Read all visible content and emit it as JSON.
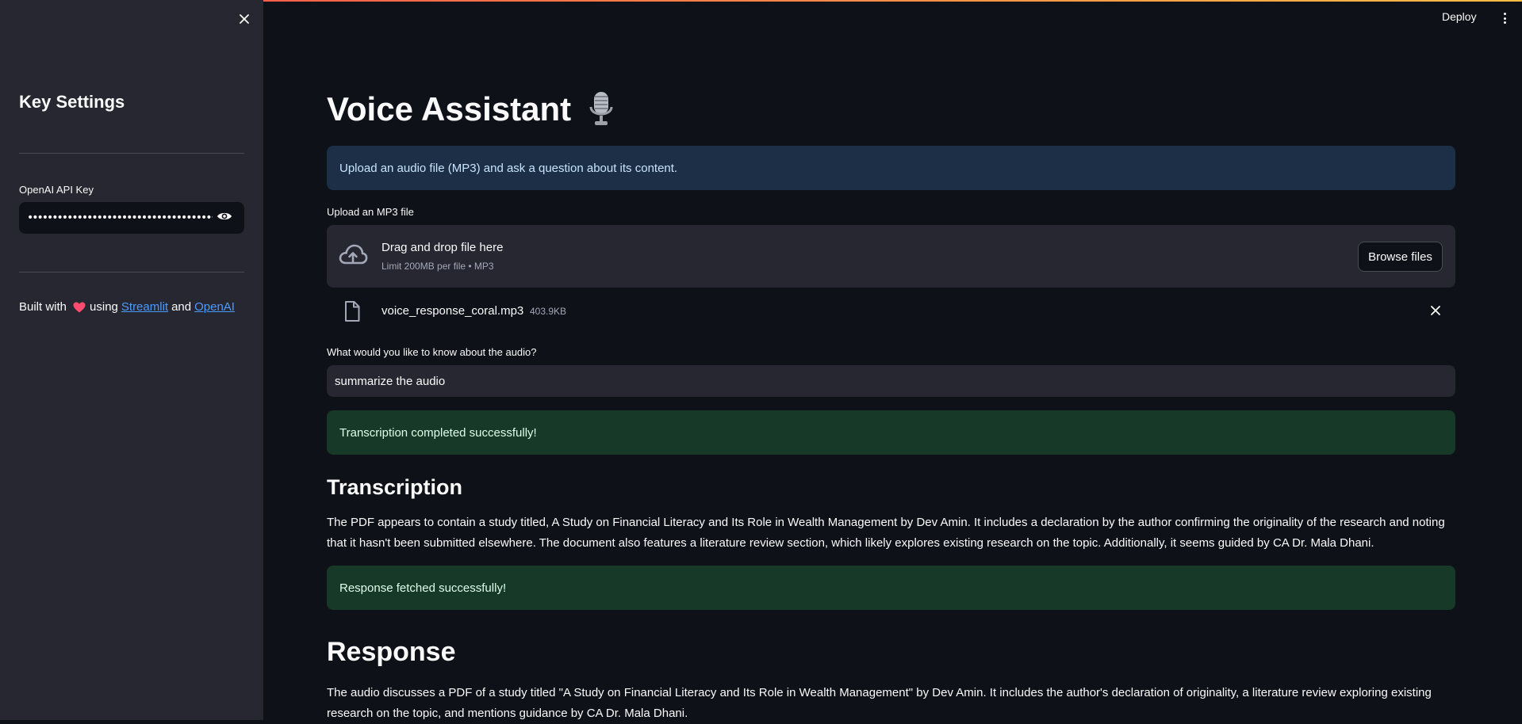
{
  "header": {
    "deploy_label": "Deploy",
    "menu_icon": "more-vertical-icon",
    "accent_gradient": [
      "#ff4b4b",
      "#ffbd45"
    ]
  },
  "sidebar": {
    "close_icon": "close-icon",
    "title": "Key Settings",
    "api_key": {
      "label": "OpenAI API Key",
      "value": "••••••••••••••••••••••••••••••••••••••••••••••••••••••",
      "toggle_icon": "eye-icon"
    },
    "footer": {
      "prefix": "Built with",
      "heart_icon": "heart-icon",
      "using": "using",
      "link1": "Streamlit",
      "and": "and",
      "link2": "OpenAI"
    }
  },
  "main": {
    "title": "Voice Assistant",
    "title_icon": "microphone-icon",
    "info_message": "Upload an audio file (MP3) and ask a question about its content.",
    "uploader": {
      "label": "Upload an MP3 file",
      "drop_title": "Drag and drop file here",
      "drop_subtitle": "Limit 200MB per file • MP3",
      "browse_label": "Browse files",
      "upload_icon": "cloud-upload-icon"
    },
    "uploaded_file": {
      "name": "voice_response_coral.mp3",
      "size": "403.9KB",
      "file_icon": "file-icon",
      "remove_icon": "close-icon"
    },
    "question": {
      "label": "What would you like to know about the audio?",
      "value": "summarize the audio"
    },
    "transcription_status": "Transcription completed successfully!",
    "transcription_heading": "Transcription",
    "transcription_text": "The PDF appears to contain a study titled, A Study on Financial Literacy and Its Role in Wealth Management by Dev Amin. It includes a declaration by the author confirming the originality of the research and noting that it hasn't been submitted elsewhere. The document also features a literature review section, which likely explores existing research on the topic. Additionally, it seems guided by CA Dr. Mala Dhani.",
    "response_status": "Response fetched successfully!",
    "response_heading": "Response",
    "response_text": "The audio discusses a PDF of a study titled \"A Study on Financial Literacy and Its Role in Wealth Management\" by Dev Amin. It includes the author's declaration of originality, a literature review exploring existing research on the topic, and mentions guidance by CA Dr. Mala Dhani."
  },
  "colors": {
    "background": "#0e1117",
    "sidebar": "#262730",
    "info_bg": "#1c2f47",
    "success_bg": "#173928",
    "link": "#4c9bff"
  }
}
